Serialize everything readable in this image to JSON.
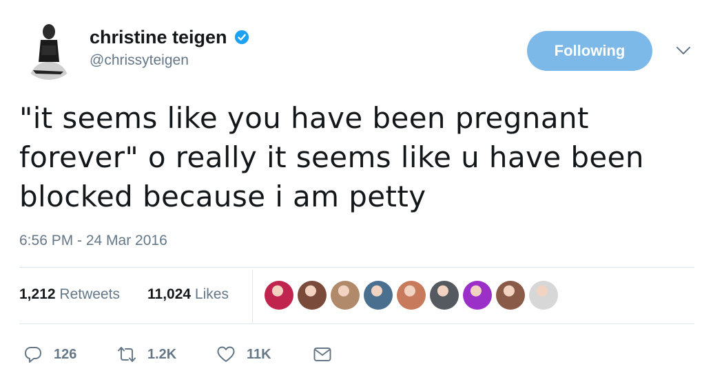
{
  "author": {
    "display_name": "christine teigen",
    "handle": "@chrissyteigen",
    "verified": true,
    "avatar_icon": "profile-photo"
  },
  "follow_button": {
    "label": "Following",
    "color": "#7cb9e8"
  },
  "menu_icon": "chevron-down-icon",
  "tweet": {
    "line1": "\"it seems like you have been pregnant",
    "line2": "forever\" o really it seems like u have been",
    "line3": "blocked because i am petty",
    "timestamp": "6:56 PM - 24 Mar 2016"
  },
  "stats": {
    "retweets_count": "1,212",
    "retweets_label": "Retweets",
    "likes_count": "11,024",
    "likes_label": "Likes"
  },
  "likers": [
    {
      "name": "liker-1",
      "color": "#c0254f"
    },
    {
      "name": "liker-2",
      "color": "#7a4a3a"
    },
    {
      "name": "liker-3",
      "color": "#b08a6a"
    },
    {
      "name": "liker-4",
      "color": "#4a6f8f"
    },
    {
      "name": "liker-5",
      "color": "#c77a5c"
    },
    {
      "name": "liker-6",
      "color": "#555a60"
    },
    {
      "name": "liker-7",
      "color": "#9b30c8"
    },
    {
      "name": "liker-8",
      "color": "#8a5a48"
    },
    {
      "name": "liker-9",
      "color": "#d7d7d7"
    }
  ],
  "actions": {
    "reply_count": "126",
    "retweet_count": "1.2K",
    "like_count": "11K"
  },
  "colors": {
    "accent": "#1da1f2",
    "muted": "#657786",
    "text": "#14171a"
  }
}
